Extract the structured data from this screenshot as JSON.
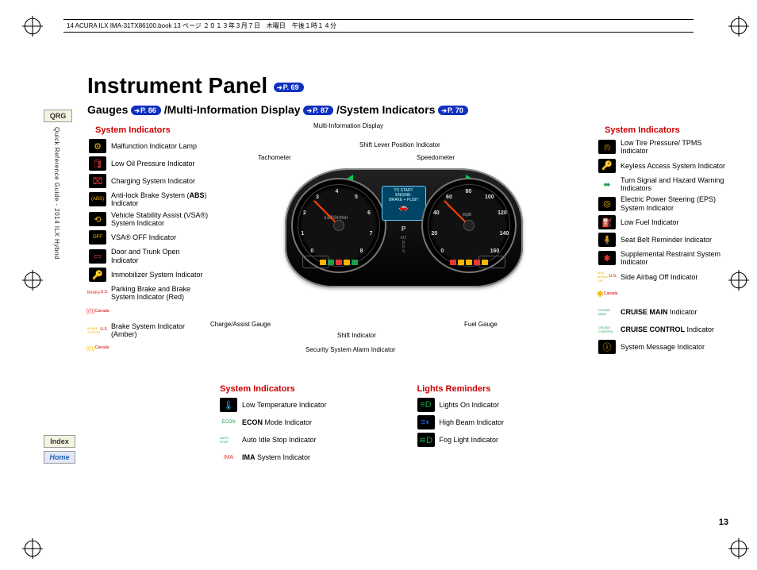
{
  "print_header": "14 ACURA ILX IMA-31TX86100.book  13 ページ  ２０１３年３月７日　木曜日　午後１時１４分",
  "sidebar": {
    "qrg": "QRG",
    "guide": "Quick Reference Guide - 2014 ILX Hybrid",
    "index": "Index",
    "home": "Home"
  },
  "title": "Instrument Panel",
  "title_page_ref": "P. 69",
  "subheader": {
    "gauges": "Gauges",
    "gauges_ref": "P. 86",
    "mid": "/Multi-Information Display",
    "mid_ref": "P. 87",
    "sys": "/System Indicators",
    "sys_ref": "P. 70"
  },
  "labels": {
    "mid": "Multi-Information Display",
    "shift_pos": "Shift Lever Position Indicator",
    "tach": "Tachometer",
    "speedo": "Speedometer",
    "charge": "Charge/Assist Gauge",
    "fuel": "Fuel Gauge",
    "shift_ind": "Shift Indicator",
    "security": "Security System Alarm Indicator"
  },
  "dial": {
    "tach_unit": "x1000r/min",
    "tach_nums": [
      "0",
      "1",
      "2",
      "3",
      "4",
      "5",
      "6",
      "7",
      "8"
    ],
    "spd_unit": "mph",
    "spd_nums": [
      "0",
      "20",
      "40",
      "60",
      "80",
      "100",
      "120",
      "140",
      "160"
    ],
    "mid_text1": "TO START",
    "mid_text2": "ENGINE:",
    "mid_text3": "BRAKE + PUSH"
  },
  "sections": {
    "sys_ind": "System Indicators",
    "lights": "Lights Reminders"
  },
  "left_indicators": [
    {
      "n": "mil",
      "c": "#f7b500",
      "g": "⚙",
      "t": "Malfunction Indicator Lamp"
    },
    {
      "n": "oil",
      "c": "#e53935",
      "g": "🛢",
      "t": "Low Oil Pressure Indicator"
    },
    {
      "n": "charge",
      "c": "#e53935",
      "g": "⌧",
      "t": "Charging System Indicator"
    },
    {
      "n": "abs",
      "c": "#f7b500",
      "g": "(ABS)",
      "sz": "6px",
      "t": "Anti-lock Brake System (<b>ABS</b>) Indicator"
    },
    {
      "n": "vsa",
      "c": "#f7b500",
      "g": "⟲",
      "t": "Vehicle Stability Assist (VSA®) System Indicator"
    },
    {
      "n": "vsa-off",
      "c": "#f7b500",
      "g": "OFF",
      "sz": "6px",
      "t": "VSA® OFF Indicator"
    },
    {
      "n": "door",
      "c": "#e53935",
      "g": "▭",
      "t": "Door and Trunk Open Indicator"
    },
    {
      "n": "immob",
      "c": "#17a24a",
      "g": "🔑",
      "t": "Immobilizer System Indicator"
    },
    {
      "n": "brake-red",
      "c": "#e53935",
      "g": "BRAKE",
      "sz": "5px",
      "noback": true,
      "sub": "U.S.",
      "t": "Parking Brake and Brake System Indicator (Red)"
    },
    {
      "n": "brake-red-ca",
      "c": "#e53935",
      "g": "((!))",
      "sz": "7px",
      "noback": true,
      "sub": "Canada",
      "t": ""
    },
    {
      "n": "brake-amber",
      "c": "#f7b500",
      "g": "BRAKE SYSTEM",
      "sz": "4px",
      "noback": true,
      "sub": "U.S.",
      "t": "Brake System Indicator (Amber)"
    },
    {
      "n": "brake-amber-ca",
      "c": "#f7b500",
      "g": "((!))",
      "sz": "7px",
      "noback": true,
      "sub": "Canada",
      "t": ""
    }
  ],
  "mid_indicators": [
    {
      "n": "low-temp",
      "c": "#2bb6e6",
      "g": "🌡",
      "t": "Low Temperature Indicator"
    },
    {
      "n": "econ",
      "c": "#17a24a",
      "g": "ECON",
      "sz": "6px",
      "noback": true,
      "t": "<b>ECON</b> Mode Indicator"
    },
    {
      "n": "auto-idle",
      "c": "#17a24a",
      "g": "AUTO STOP",
      "sz": "4px",
      "noback": true,
      "t": "Auto Idle Stop Indicator"
    },
    {
      "n": "ima",
      "c": "#e53935",
      "g": "IMA",
      "sz": "7px",
      "noback": true,
      "t": "<b>IMA</b> System Indicator"
    }
  ],
  "lights_indicators": [
    {
      "n": "lights-on",
      "c": "#17a24a",
      "g": "≡D",
      "t": "Lights On Indicator"
    },
    {
      "n": "high-beam",
      "c": "#2060e0",
      "g": "≡◐",
      "t": "High Beam Indicator"
    },
    {
      "n": "fog",
      "c": "#17a24a",
      "g": "≋D",
      "t": "Fog Light Indicator"
    }
  ],
  "right_indicators": [
    {
      "n": "tpms",
      "c": "#f7b500",
      "g": "(!)",
      "sz": "8px",
      "t": "Low Tire Pressure/ TPMS Indicator"
    },
    {
      "n": "keyless",
      "c": "#f7b500",
      "g": "🔑",
      "t": "Keyless Access System Indicator"
    },
    {
      "n": "turn",
      "c": "#17a24a",
      "g": "⬌",
      "noback": true,
      "t": "Turn Signal and Hazard Warning Indicators"
    },
    {
      "n": "eps",
      "c": "#f7b500",
      "g": "◎",
      "t": "Electric Power Steering (EPS) System Indicator"
    },
    {
      "n": "low-fuel",
      "c": "#f7b500",
      "g": "⛽",
      "t": "Low Fuel Indicator"
    },
    {
      "n": "seatbelt",
      "c": "#e53935",
      "g": "🧍",
      "t": "Seat Belt Reminder Indicator"
    },
    {
      "n": "srs",
      "c": "#e53935",
      "g": "✱",
      "t": "Supplemental Restraint System Indicator"
    },
    {
      "n": "side-airbag",
      "c": "#f7b500",
      "g": "SIDE AIRBAG OFF",
      "sz": "4px",
      "noback": true,
      "sub": "U.S.",
      "t": "Side Airbag Off Indicator"
    },
    {
      "n": "side-airbag-ca",
      "c": "#f7b500",
      "g": "✱",
      "noback": true,
      "sub": "Canada",
      "t": ""
    },
    {
      "n": "cruise-main",
      "c": "#17a24a",
      "g": "CRUISE MAIN",
      "sz": "4px",
      "noback": true,
      "t": "<b>CRUISE MAIN</b> Indicator"
    },
    {
      "n": "cruise-ctrl",
      "c": "#17a24a",
      "g": "CRUISE CONTROL",
      "sz": "4px",
      "noback": true,
      "t": "<b>CRUISE CONTROL</b> Indicator"
    },
    {
      "n": "sys-msg",
      "c": "#f7b500",
      "g": "ⓘ",
      "t": "System Message Indicator"
    }
  ],
  "page_number": "13"
}
